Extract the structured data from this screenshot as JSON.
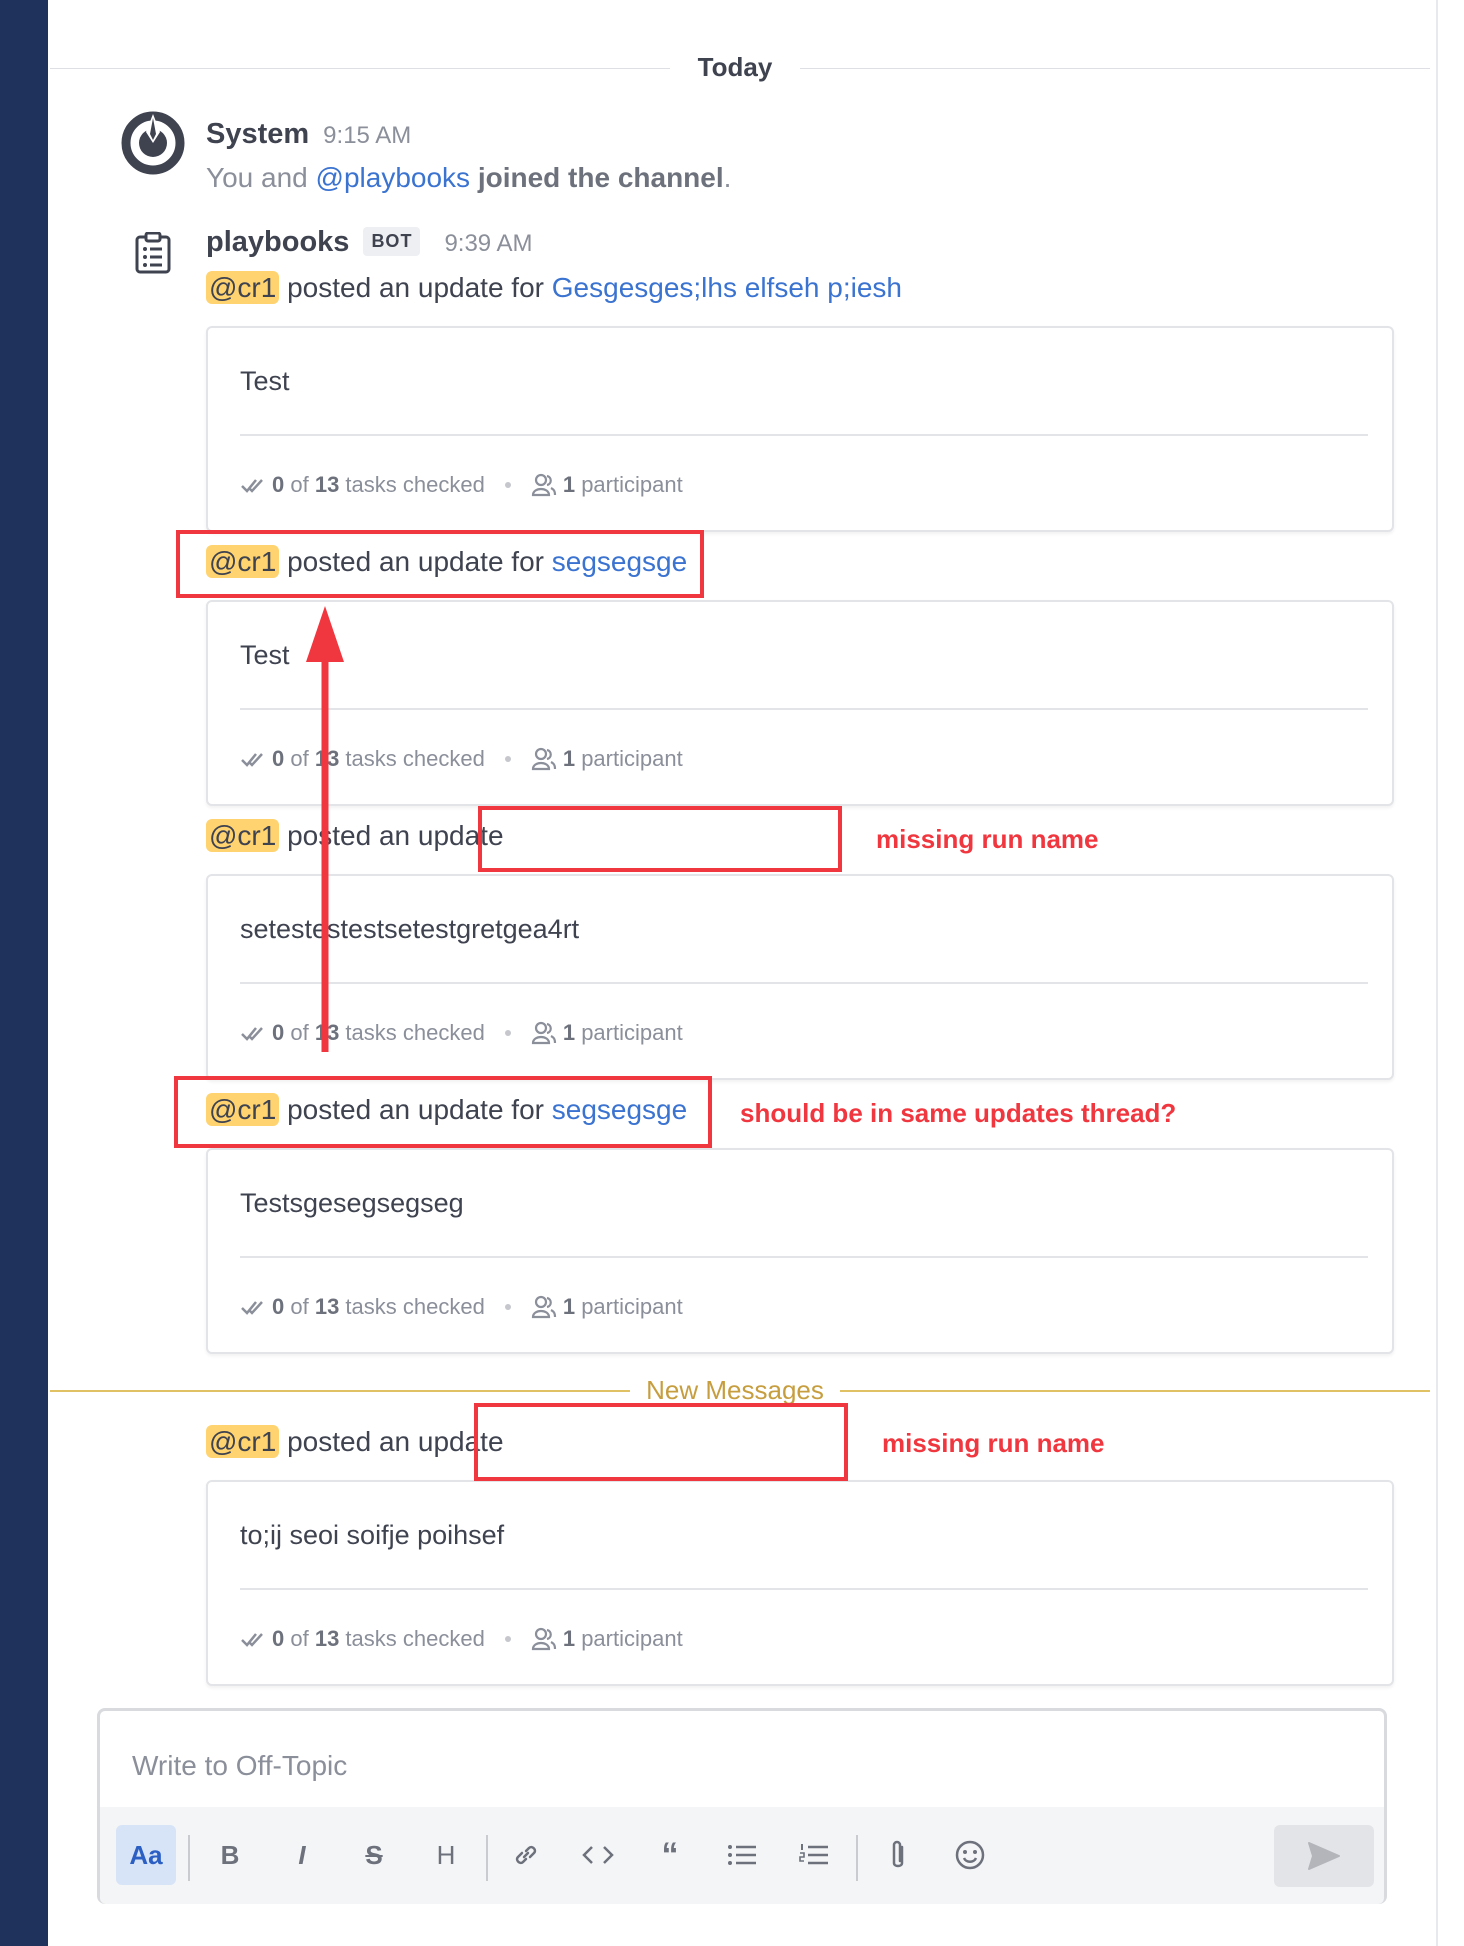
{
  "date_separator": "Today",
  "new_messages_separator": "New Messages",
  "system_post": {
    "author": "System",
    "time": "9:15 AM",
    "text_prefix": "You and ",
    "mention": "@playbooks",
    "text_bold": " joined the channel",
    "text_suffix": "."
  },
  "bot_post": {
    "author": "playbooks",
    "badge": "BOT",
    "time": "9:39 AM"
  },
  "updates": [
    {
      "mention": "@cr1",
      "text": " posted an update for ",
      "run_name": "Gesgesges;lhs elfseh p;iesh",
      "message": "Test",
      "tasks_checked": "0",
      "tasks_total": "13",
      "tasks_label": " tasks checked",
      "participants": "1",
      "participants_label": " participant"
    },
    {
      "mention": "@cr1",
      "text": " posted an update for ",
      "run_name": "segsegsge",
      "message": "Test",
      "tasks_checked": "0",
      "tasks_total": "13",
      "tasks_label": " tasks checked",
      "participants": "1",
      "participants_label": " participant"
    },
    {
      "mention": "@cr1",
      "text": " posted an update",
      "run_name": "",
      "message": "setestestestsetestgretgea4rt",
      "tasks_checked": "0",
      "tasks_total": "13",
      "tasks_label": " tasks checked",
      "participants": "1",
      "participants_label": " participant"
    },
    {
      "mention": "@cr1",
      "text": " posted an update for ",
      "run_name": "segsegsge",
      "message": "Testsgesegsegseg",
      "tasks_checked": "0",
      "tasks_total": "13",
      "tasks_label": " tasks checked",
      "participants": "1",
      "participants_label": " participant"
    },
    {
      "mention": "@cr1",
      "text": " posted an update",
      "run_name": "",
      "message": "to;ij seoi soifje poihsef",
      "tasks_checked": "0",
      "tasks_total": "13",
      "tasks_label": " tasks checked",
      "participants": "1",
      "participants_label": " participant"
    }
  ],
  "stat_of": " of ",
  "annotations": {
    "missing_1": "missing run name",
    "thread_question": "should be in same updates thread?",
    "missing_2": "missing run name",
    "color": "#f0373f"
  },
  "composer": {
    "placeholder": "Write to Off-Topic",
    "tools": [
      "Aa",
      "B",
      "I",
      "S",
      "H",
      "link-icon",
      "code-icon",
      "quote-icon",
      "bullet-list-icon",
      "numbered-list-icon",
      "attachment-icon",
      "emoji-icon"
    ],
    "send_icon": "send-icon"
  }
}
